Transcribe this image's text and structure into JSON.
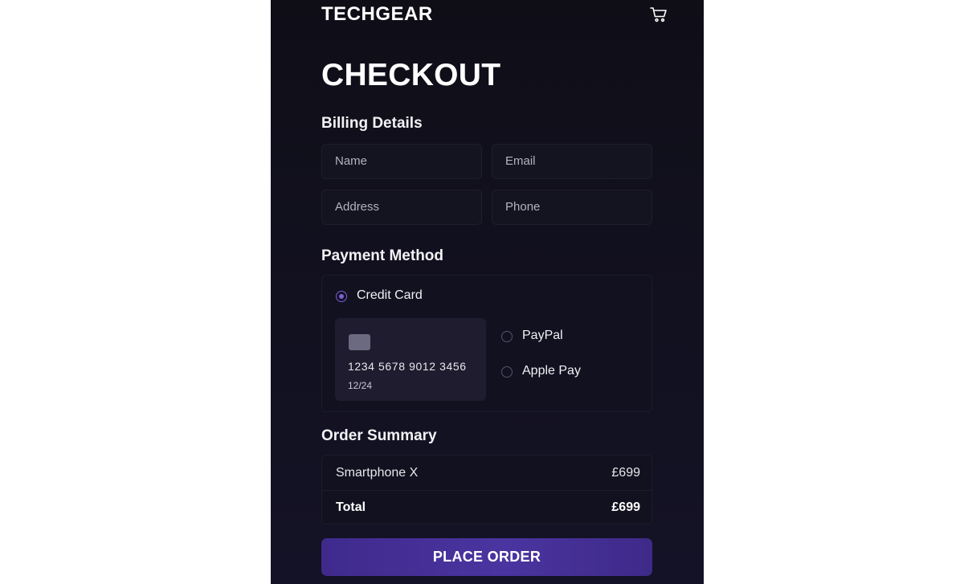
{
  "header": {
    "brand": "TECHGEAR",
    "cart_icon": "cart-icon"
  },
  "page": {
    "title": "CHECKOUT"
  },
  "billing": {
    "heading": "Billing Details",
    "name_placeholder": "Name",
    "email_placeholder": "Email",
    "address_placeholder": "Address",
    "phone_placeholder": "Phone"
  },
  "payment": {
    "heading": "Payment Method",
    "selected": "Credit Card",
    "options": [
      {
        "label": "Credit Card",
        "selected": true
      },
      {
        "label": "PayPal",
        "selected": false
      },
      {
        "label": "Apple Pay",
        "selected": false
      }
    ],
    "card": {
      "number": "1234  5678 9012 3456",
      "expiry": "12/24"
    }
  },
  "summary": {
    "heading": "Order Summary",
    "items": [
      {
        "name": "Smartphone X",
        "price": "£699"
      }
    ],
    "total_label": "Total",
    "total_value": "£699"
  },
  "cta": {
    "label": "PLACE ORDER"
  },
  "colors": {
    "background": "#0f0e17",
    "accent": "#7a5fd6",
    "button": "#4a34a0"
  }
}
